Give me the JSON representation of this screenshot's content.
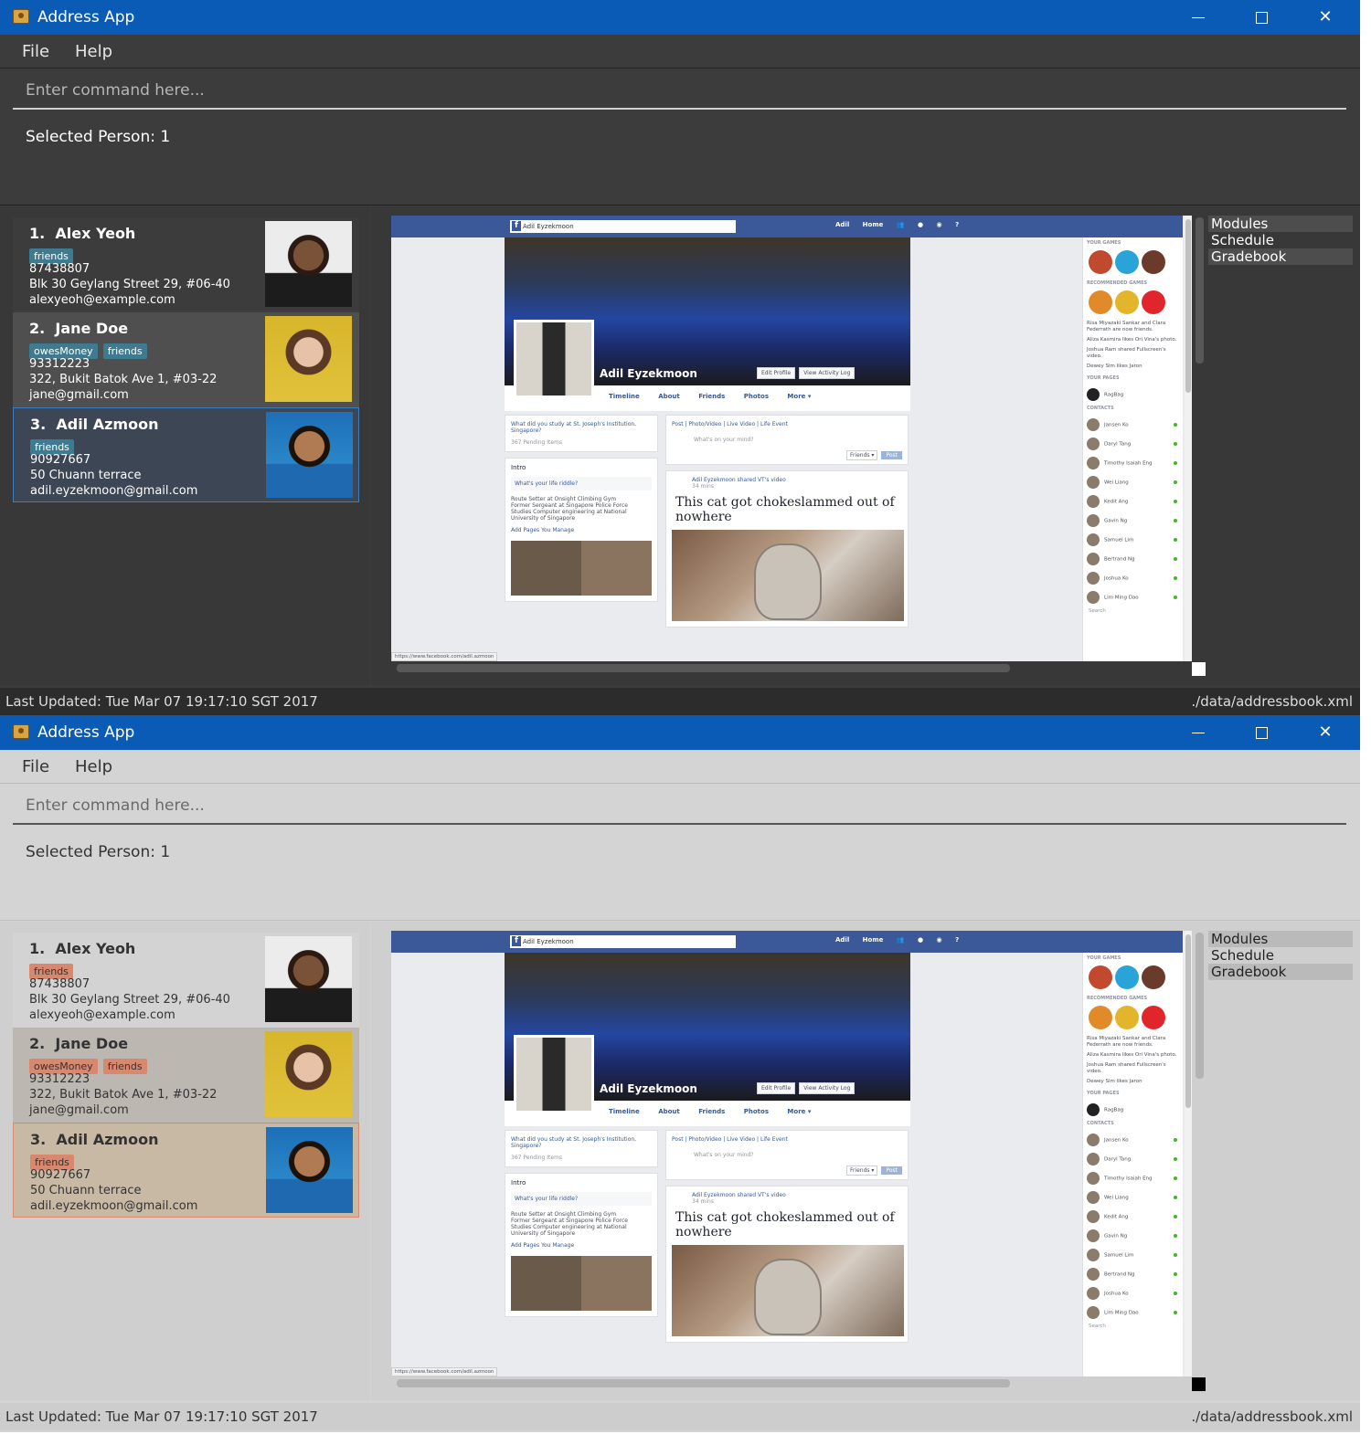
{
  "app": {
    "title": "Address App"
  },
  "menu": {
    "file": "File",
    "help": "Help"
  },
  "command": {
    "placeholder": "Enter command here..."
  },
  "result": {
    "text": "Selected Person: 1"
  },
  "persons": [
    {
      "index": "1.",
      "name": "Alex Yeoh",
      "tags": [
        "friends"
      ],
      "phone": "87438807",
      "address": "Blk 30 Geylang Street 29, #06-40",
      "email": "alexyeoh@example.com"
    },
    {
      "index": "2.",
      "name": "Jane Doe",
      "tags": [
        "owesMoney",
        "friends"
      ],
      "phone": "93312223",
      "address": "322, Bukit Batok Ave 1, #03-22",
      "email": "jane@gmail.com"
    },
    {
      "index": "3.",
      "name": "Adil Azmoon",
      "tags": [
        "friends"
      ],
      "phone": "90927667",
      "address": "50 Chuann terrace",
      "email": "adil.eyzekmoon@gmail.com"
    }
  ],
  "browser": {
    "search": "Adil Eyzekmoon",
    "nav": [
      "Adil",
      "Home"
    ],
    "profile_name": "Adil Eyzekmoon",
    "edit_profile": "Edit Profile",
    "view_activity": "View Activity Log",
    "tabs": [
      "Timeline",
      "About",
      "Friends",
      "Photos",
      "More ▾"
    ],
    "study_prompt": "What did you study at St. Joseph's Institution, Singapore?",
    "pending": "367 Pending Items",
    "intro": "Intro",
    "riddle": "What's your life riddle?",
    "work1": "Route Setter at Onsight Climbing Gym",
    "work2": "Former Sergeant at Singapore Police Force",
    "work3": "Studies Computer engineering at National University of Singapore",
    "pages": "Add Pages You Manage",
    "composer_tabs": "Post | Photo/Video | Live Video | Life Event",
    "composer_prompt": "What's on your mind?",
    "friends_btn": "Friends ▾",
    "post_btn": "Post",
    "shared_by": "Adil Eyzekmoon shared VT's video",
    "time": "34 mins",
    "post_title": "This cat got chokeslammed out of nowhere",
    "your_games": "YOUR GAMES",
    "recommended": "RECOMMENDED GAMES",
    "your_pages": "YOUR PAGES",
    "page_name": "RagBag",
    "contacts_label": "CONTACTS",
    "news": [
      "Risa Miyazaki Sankar and Clara Federrath are now friends.",
      "Aliza Kasmira likes Ori Vina's photo.",
      "Joshua Ram shared Fullscreen's video.",
      "Dewey Sim likes Jaron"
    ],
    "contacts": [
      "Jansen Ko",
      "Daryl Tang",
      "Timothy Isaiah Eng",
      "Wei Liang",
      "Kedit Ang",
      "Gavin Ng",
      "Samuel Lim",
      "Bertrand Ng",
      "Joshua Ko",
      "Lim Ming Dao"
    ],
    "chat_search": "Search",
    "status_url": "https://www.facebook.com/adil.azmoon"
  },
  "side_list": [
    "Modules",
    "Schedule",
    "Gradebook"
  ],
  "status": {
    "last_updated": "Last Updated: Tue Mar 07 19:17:10 SGT 2017",
    "path": "./data/addressbook.xml"
  }
}
